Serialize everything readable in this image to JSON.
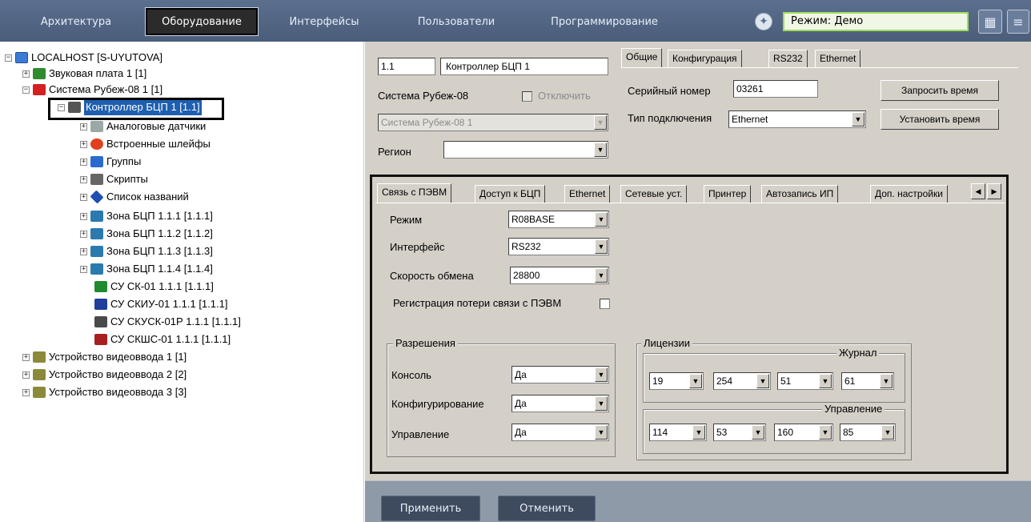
{
  "menu": {
    "tabs": [
      "Архитектура",
      "Оборудование",
      "Интерфейсы",
      "Пользователи",
      "Программирование"
    ],
    "active_tab": "Оборудование",
    "mode_label": "Режим: Демо"
  },
  "tree": {
    "items": [
      {
        "label": "LOCALHOST [S-UYUTOVA]",
        "icon": "computer-icon"
      },
      {
        "label": "Звуковая плата 1 [1]",
        "icon": "sound-card-icon"
      },
      {
        "label": "Система Рубеж-08 1 [1]",
        "icon": "rubezh-system-icon"
      },
      {
        "label": "Контроллер БЦП 1 [1.1]",
        "icon": "controller-icon"
      },
      {
        "label": "Аналоговые датчики",
        "icon": "analog-sensors-icon"
      },
      {
        "label": "Встроенные шлейфы",
        "icon": "loops-icon"
      },
      {
        "label": "Группы",
        "icon": "groups-icon"
      },
      {
        "label": "Скрипты",
        "icon": "scripts-icon"
      },
      {
        "label": "Список названий",
        "icon": "names-list-icon"
      },
      {
        "label": "Зона БЦП 1.1.1 [1.1.1]",
        "icon": "zone-icon"
      },
      {
        "label": "Зона БЦП 1.1.2 [1.1.2]",
        "icon": "zone-icon"
      },
      {
        "label": "Зона БЦП 1.1.3 [1.1.3]",
        "icon": "zone-icon"
      },
      {
        "label": "Зона БЦП 1.1.4 [1.1.4]",
        "icon": "zone-icon"
      },
      {
        "label": "СУ СК-01 1.1.1 [1.1.1]",
        "icon": "su-sk-icon"
      },
      {
        "label": "СУ СКИУ-01 1.1.1 [1.1.1]",
        "icon": "su-skiu-icon"
      },
      {
        "label": "СУ СКУСК-01Р 1.1.1 [1.1.1]",
        "icon": "su-skusk-icon"
      },
      {
        "label": "СУ СКШС-01 1.1.1 [1.1.1]",
        "icon": "su-skshs-icon"
      },
      {
        "label": "Устройство видеоввода 1 [1]",
        "icon": "video-input-icon"
      },
      {
        "label": "Устройство видеоввода 2 [2]",
        "icon": "video-input-icon"
      },
      {
        "label": "Устройство видеоввода 3 [3]",
        "icon": "video-input-icon"
      }
    ]
  },
  "object": {
    "id": "1.1",
    "name": "Контроллер БЦП 1",
    "system_label": "Система Рубеж-08",
    "disable_label": "Отключить",
    "system_value": "Система Рубеж-08 1",
    "region_label": "Регион",
    "region_value": ""
  },
  "general": {
    "tabs": [
      "Общие",
      "Конфигурация",
      "RS232",
      "Ethernet"
    ],
    "serial_label": "Серийный номер",
    "serial_value": "03261",
    "connection_label": "Тип подключения",
    "connection_value": "Ethernet",
    "request_time": "Запросить время",
    "set_time": "Установить время"
  },
  "settings": {
    "tabs": [
      "Связь с ПЭВМ",
      "Доступ к БЦП",
      "Ethernet",
      "Сетевые уст.",
      "Принтер",
      "Автозапись ИП",
      "Доп. настройки"
    ],
    "mode_label": "Режим",
    "mode_value": "R08BASE",
    "interface_label": "Интерфейс",
    "interface_value": "RS232",
    "speed_label": "Скорость обмена",
    "speed_value": "28800",
    "lost_link_label": "Регистрация потери связи с ПЭВМ"
  },
  "permissions": {
    "title": "Разрешения",
    "console_label": "Консоль",
    "console_value": "Да",
    "config_label": "Конфигурирование",
    "config_value": "Да",
    "control_label": "Управление",
    "control_value": "Да"
  },
  "licenses": {
    "title": "Лицензии",
    "journal_title": "Журнал",
    "journal_values": [
      "19",
      "254",
      "51",
      "61"
    ],
    "control_title": "Управление",
    "control_values": [
      "114",
      "53",
      "160",
      "85"
    ]
  },
  "footer": {
    "apply": "Применить",
    "cancel": "Отменить"
  }
}
